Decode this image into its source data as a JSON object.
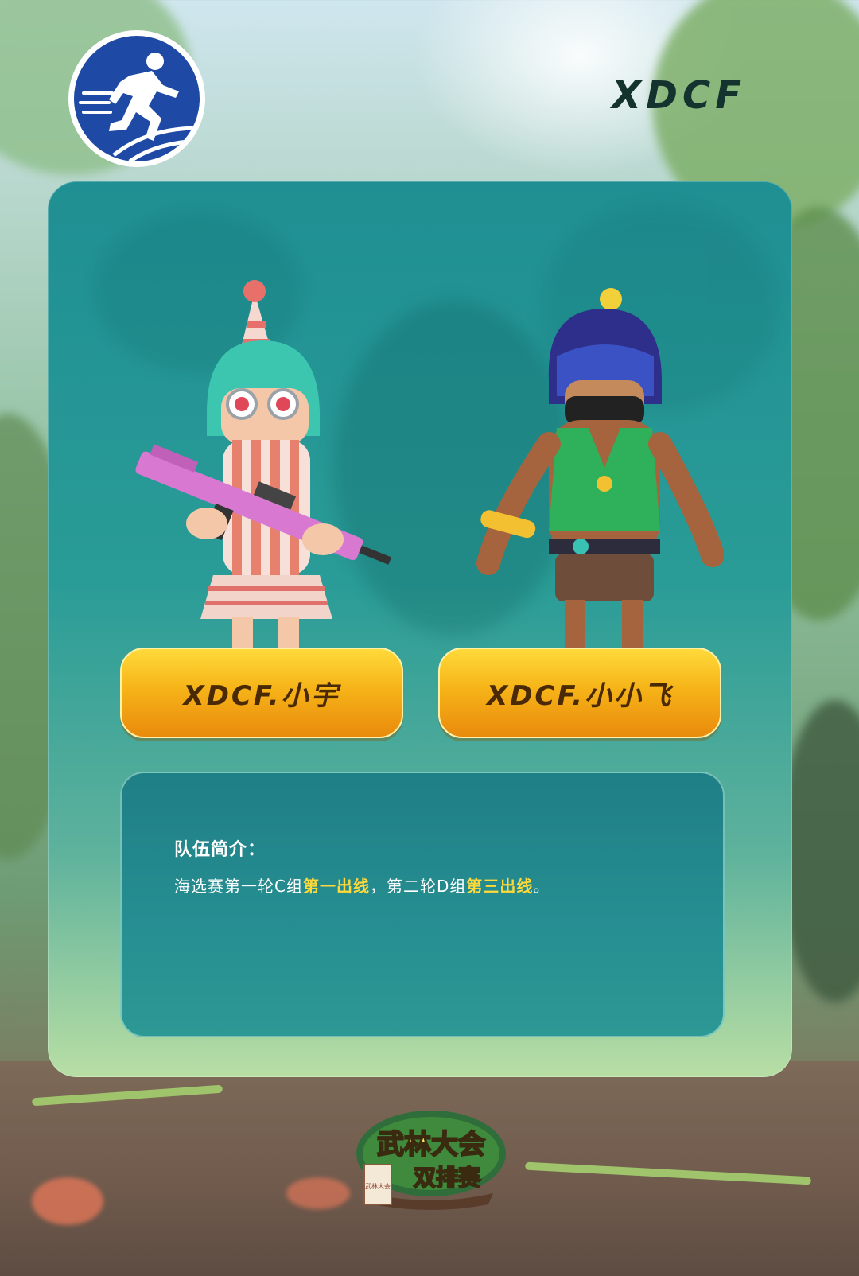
{
  "header": {
    "team_name": "XDCF",
    "logo_icon": "running-man-icon"
  },
  "players": [
    {
      "name": "XDCF.小宇",
      "avatar": "party-hat-girl-with-pink-rifle"
    },
    {
      "name": "XDCF.小小飞",
      "avatar": "masked-hero-in-green-vest"
    }
  ],
  "intro": {
    "heading": "队伍简介：",
    "text_1": "海选赛第一轮C组",
    "highlight_1": "第一出线",
    "text_2": "，第二轮D组",
    "highlight_2": "第三出线",
    "text_3": "。"
  },
  "event_logo": {
    "line1": "武林大会",
    "line2": "双排赛",
    "small": "武林大会"
  },
  "colors": {
    "button_gold": "#f6b418",
    "highlight_yellow": "#ffd83a",
    "card_teal": "#2a9c97",
    "logo_blue": "#1e4aa6"
  }
}
